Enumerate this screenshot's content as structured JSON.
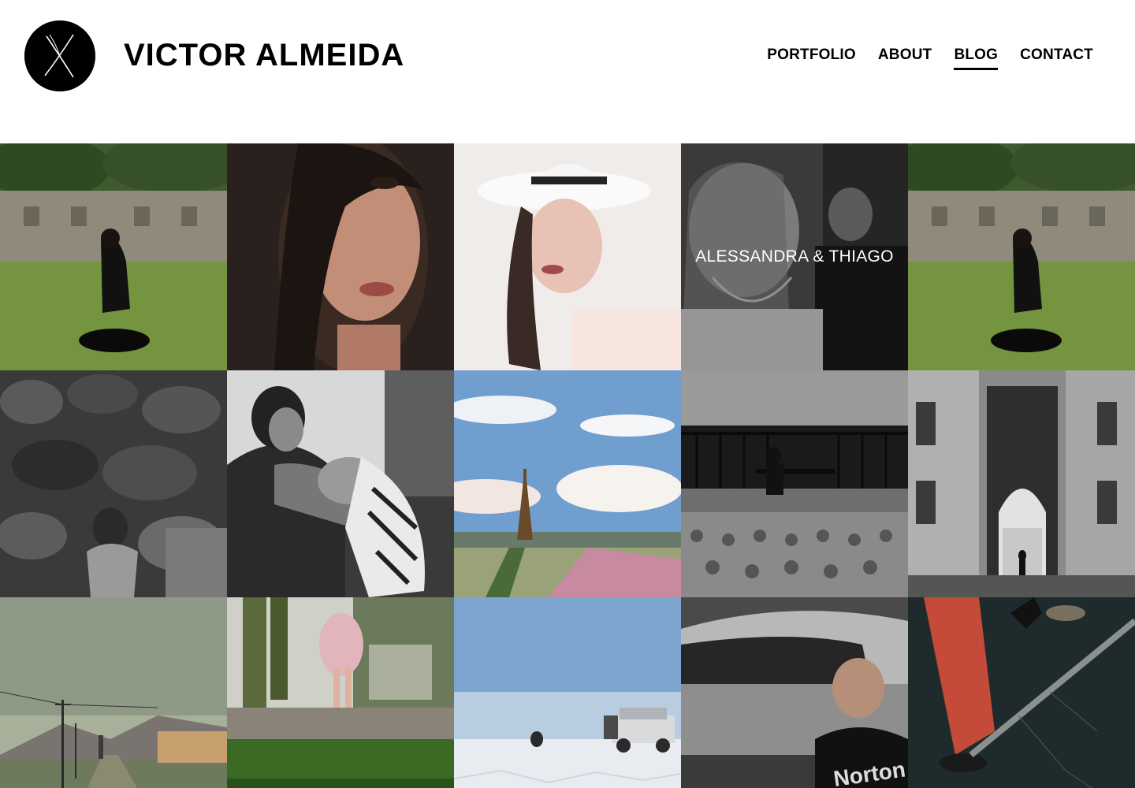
{
  "site": {
    "title": "VICTOR ALMEIDA",
    "logo_icon": "x-monogram-logo"
  },
  "nav": {
    "items": [
      {
        "label": "PORTFOLIO",
        "active": false
      },
      {
        "label": "ABOUT",
        "active": false
      },
      {
        "label": "BLOG",
        "active": true
      },
      {
        "label": "CONTACT",
        "active": false
      }
    ]
  },
  "gallery": {
    "tiles": [
      {
        "subject": "woman-in-field-ruins"
      },
      {
        "subject": "portrait-dark-hair"
      },
      {
        "subject": "woman-white-hat"
      },
      {
        "subject": "wedding-couple",
        "caption": "ALESSANDRA & THIAGO"
      },
      {
        "subject": "woman-in-field-ruins"
      },
      {
        "subject": "woman-stone-wall"
      },
      {
        "subject": "woman-with-cat"
      },
      {
        "subject": "eiffel-tower"
      },
      {
        "subject": "man-on-bench-waterfront"
      },
      {
        "subject": "archway-building"
      },
      {
        "subject": "road-power-lines"
      },
      {
        "subject": "child-feet-grass"
      },
      {
        "subject": "salt-flat-jeep"
      },
      {
        "subject": "man-by-car"
      },
      {
        "subject": "red-trousers-water"
      }
    ]
  },
  "colors": {
    "accent": "#000000",
    "background": "#ffffff",
    "caption_text": "#ffffff"
  }
}
